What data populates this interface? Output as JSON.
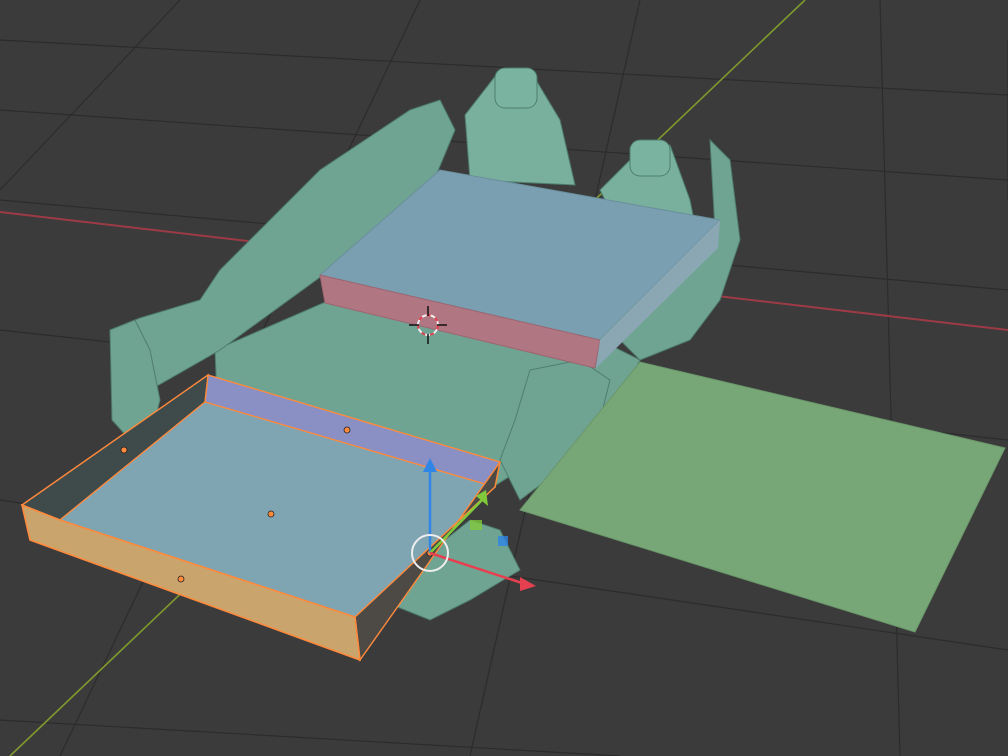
{
  "viewport": {
    "background": "#3b3b3b",
    "grid_color": "#2a2a2a",
    "x_axis_color": "#9c3b45",
    "y_axis_color": "#7f9a2c"
  },
  "scene_objects": [
    {
      "name": "car-interior-scan",
      "color": "#6fa493"
    },
    {
      "name": "storage-drawer",
      "selected": true,
      "color": "#7fa5b3",
      "outline": "#ff8a3c"
    },
    {
      "name": "bed-platform",
      "color": "#7a9fb0"
    },
    {
      "name": "ground-plane",
      "color": "#78a777"
    }
  ],
  "gizmo": {
    "x_color": "#e5404f",
    "y_color": "#7fc93b",
    "z_color": "#2f86e6",
    "cursor_color": "#dddddd"
  },
  "icons": [
    "3d-cursor-icon",
    "transform-gizmo-icon",
    "origin-dot-icon"
  ]
}
